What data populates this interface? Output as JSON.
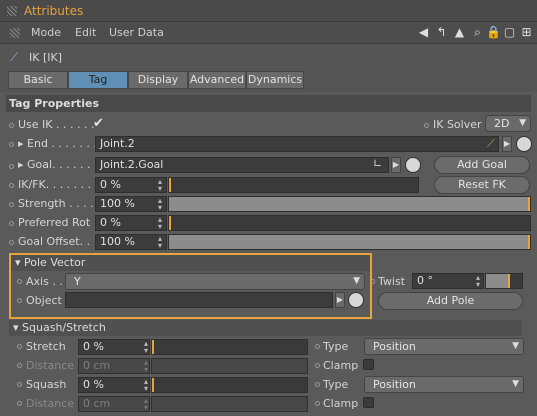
{
  "window": {
    "title": "Attributes"
  },
  "menu": {
    "mode": "Mode",
    "edit": "Edit",
    "user_data": "User Data"
  },
  "object": {
    "name": "IK [IK]"
  },
  "tabs": [
    "Basic",
    "Tag",
    "Display",
    "Advanced",
    "Dynamics"
  ],
  "active_tab": "Tag",
  "tag_properties": {
    "header": "Tag Properties",
    "use_ik_label": "Use IK . . . . . .",
    "ik_solver_label": "IK Solver",
    "ik_solver_value": "2D",
    "end_label": "End . . . . . . .",
    "end_value": "Joint.2",
    "goal_label": "Goal. . . . . . .",
    "goal_value": "Joint.2.Goal",
    "add_goal": "Add Goal",
    "ikfk_label": "IK/FK. . . . . . .",
    "ikfk_value": "0 %",
    "ikfk_level": 0,
    "reset_fk": "Reset FK",
    "strength_label": "Strength . . . .",
    "strength_value": "100 %",
    "strength_level": 1.0,
    "preferred_rot_label": "Preferred Rot",
    "preferred_rot_value": "0 %",
    "preferred_rot_level": 0,
    "goal_offset_label": "Goal Offset. .",
    "goal_offset_value": "100 %",
    "goal_offset_level": 1.0
  },
  "pole_vector": {
    "header": "Pole Vector",
    "axis_label": "Axis . .",
    "axis_value": "Y",
    "twist_label": "Twist",
    "twist_value": "0 °",
    "object_label": "Object",
    "object_value": "",
    "add_pole": "Add Pole"
  },
  "squash_stretch": {
    "header": "Squash/Stretch",
    "stretch_label": "Stretch",
    "stretch_value": "0 %",
    "type_label": "Type",
    "type_value_1": "Position",
    "distance_label": "Distance",
    "distance_value_1": "0 cm",
    "clamp_label": "Clamp",
    "squash_label": "Squash",
    "squash_value": "0 %",
    "type_value_2": "Position",
    "distance_value_2": "0 cm"
  },
  "colors": {
    "accent": "#e8a33a",
    "active_tab": "#5f8fb5"
  }
}
